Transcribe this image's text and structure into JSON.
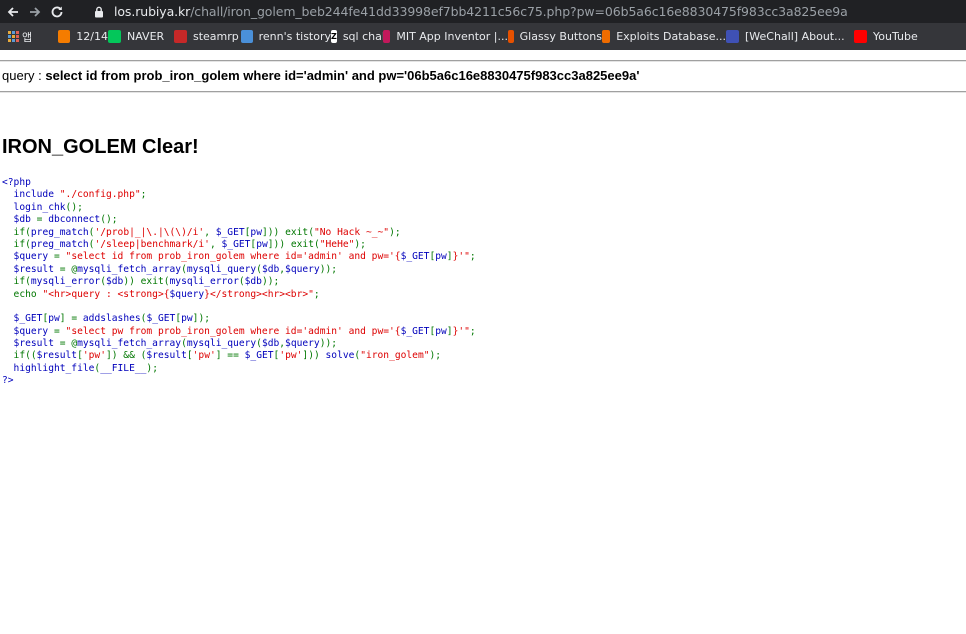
{
  "browser": {
    "url_host": "los.rubiya.kr",
    "url_path": "/chall/iron_golem_beb244fe41dd33998ef7bb4211c56c75.php?pw=06b5a6c16e8830475f983cc3a825ee9a",
    "icons": {
      "back": "back-arrow-icon",
      "forward": "forward-arrow-icon",
      "reload": "reload-icon",
      "lock": "lock-icon"
    }
  },
  "bookmarks": [
    {
      "label": "",
      "icon": "apps-grid-icon"
    },
    {
      "label": "앱",
      "icon": ""
    },
    {
      "label": "12/14",
      "icon": "blogger-icon",
      "color": "#f57c00"
    },
    {
      "label": "NAVER",
      "icon": "naver-icon",
      "color": "#03c75a"
    },
    {
      "label": "steamrp",
      "icon": "steamrp-icon",
      "color": "#c62828"
    },
    {
      "label": "renn's tistory",
      "icon": "tistory-icon",
      "color": "#4a90d9"
    },
    {
      "label": "sql chall",
      "icon": "z-icon",
      "color": "#ffffff"
    },
    {
      "label": "MIT App Inventor |...",
      "icon": "app-inventor-icon",
      "color": "#c2185b"
    },
    {
      "label": "Glassy Buttons",
      "icon": "glassy-buttons-icon",
      "color": "#e65100"
    },
    {
      "label": "Exploits Database...",
      "icon": "exploit-db-icon",
      "color": "#ef6c00"
    },
    {
      "label": "[WeChall] About...",
      "icon": "wechall-icon",
      "color": "#3f51b5"
    },
    {
      "label": "YouTube",
      "icon": "youtube-icon",
      "color": "#ff0000"
    }
  ],
  "page": {
    "query_prefix": "query : ",
    "query_sql": "select id from prob_iron_golem where id='admin' and pw='06b5a6c16e8830475f983cc3a825ee9a'",
    "clear_title": "IRON_GOLEM Clear!",
    "code_lines": [
      [
        {
          "t": "<?php",
          "c": "kw"
        }
      ],
      [
        {
          "t": "  include ",
          "c": "kw"
        },
        {
          "t": "\"./config.php\"",
          "c": "str"
        },
        {
          "t": ";",
          "c": "op"
        }
      ],
      [
        {
          "t": "  login_chk",
          "c": "kw"
        },
        {
          "t": "();",
          "c": "op"
        }
      ],
      [
        {
          "t": "  $db ",
          "c": "kw"
        },
        {
          "t": "= ",
          "c": "op"
        },
        {
          "t": "dbconnect",
          "c": "kw"
        },
        {
          "t": "();",
          "c": "op"
        }
      ],
      [
        {
          "t": "  if(",
          "c": "op"
        },
        {
          "t": "preg_match",
          "c": "kw"
        },
        {
          "t": "(",
          "c": "op"
        },
        {
          "t": "'/prob|_|\\.|\\(\\)/i'",
          "c": "str"
        },
        {
          "t": ", ",
          "c": "op"
        },
        {
          "t": "$_GET",
          "c": "kw"
        },
        {
          "t": "[",
          "c": "op"
        },
        {
          "t": "pw",
          "c": "kw"
        },
        {
          "t": "])) exit(",
          "c": "op"
        },
        {
          "t": "\"No Hack ~_~\"",
          "c": "str"
        },
        {
          "t": ");",
          "c": "op"
        }
      ],
      [
        {
          "t": "  if(",
          "c": "op"
        },
        {
          "t": "preg_match",
          "c": "kw"
        },
        {
          "t": "(",
          "c": "op"
        },
        {
          "t": "'/sleep|benchmark/i'",
          "c": "str"
        },
        {
          "t": ", ",
          "c": "op"
        },
        {
          "t": "$_GET",
          "c": "kw"
        },
        {
          "t": "[",
          "c": "op"
        },
        {
          "t": "pw",
          "c": "kw"
        },
        {
          "t": "])) exit(",
          "c": "op"
        },
        {
          "t": "\"HeHe\"",
          "c": "str"
        },
        {
          "t": ");",
          "c": "op"
        }
      ],
      [
        {
          "t": "  $query ",
          "c": "kw"
        },
        {
          "t": "= ",
          "c": "op"
        },
        {
          "t": "\"select id from prob_iron_golem where id='admin' and pw='{",
          "c": "str"
        },
        {
          "t": "$_GET",
          "c": "kw"
        },
        {
          "t": "[",
          "c": "op"
        },
        {
          "t": "pw",
          "c": "kw"
        },
        {
          "t": "]",
          "c": "op"
        },
        {
          "t": "}'\"",
          "c": "str"
        },
        {
          "t": ";",
          "c": "op"
        }
      ],
      [
        {
          "t": "  $result ",
          "c": "kw"
        },
        {
          "t": "= @",
          "c": "op"
        },
        {
          "t": "mysqli_fetch_array",
          "c": "kw"
        },
        {
          "t": "(",
          "c": "op"
        },
        {
          "t": "mysqli_query",
          "c": "kw"
        },
        {
          "t": "(",
          "c": "op"
        },
        {
          "t": "$db",
          "c": "kw"
        },
        {
          "t": ",",
          "c": "op"
        },
        {
          "t": "$query",
          "c": "kw"
        },
        {
          "t": "));",
          "c": "op"
        }
      ],
      [
        {
          "t": "  if(",
          "c": "op"
        },
        {
          "t": "mysqli_error",
          "c": "kw"
        },
        {
          "t": "(",
          "c": "op"
        },
        {
          "t": "$db",
          "c": "kw"
        },
        {
          "t": ")) exit(",
          "c": "op"
        },
        {
          "t": "mysqli_error",
          "c": "kw"
        },
        {
          "t": "(",
          "c": "op"
        },
        {
          "t": "$db",
          "c": "kw"
        },
        {
          "t": "));",
          "c": "op"
        }
      ],
      [
        {
          "t": "  echo ",
          "c": "op"
        },
        {
          "t": "\"<hr>query : <strong>{",
          "c": "str"
        },
        {
          "t": "$query",
          "c": "kw"
        },
        {
          "t": "}</strong><hr><br>\"",
          "c": "str"
        },
        {
          "t": ";",
          "c": "op"
        }
      ],
      [
        {
          "t": "",
          "c": "op"
        }
      ],
      [
        {
          "t": "  $_GET",
          "c": "kw"
        },
        {
          "t": "[",
          "c": "op"
        },
        {
          "t": "pw",
          "c": "kw"
        },
        {
          "t": "] = ",
          "c": "op"
        },
        {
          "t": "addslashes",
          "c": "kw"
        },
        {
          "t": "(",
          "c": "op"
        },
        {
          "t": "$_GET",
          "c": "kw"
        },
        {
          "t": "[",
          "c": "op"
        },
        {
          "t": "pw",
          "c": "kw"
        },
        {
          "t": "]);",
          "c": "op"
        }
      ],
      [
        {
          "t": "  $query ",
          "c": "kw"
        },
        {
          "t": "= ",
          "c": "op"
        },
        {
          "t": "\"select pw from prob_iron_golem where id='admin' and pw='{",
          "c": "str"
        },
        {
          "t": "$_GET",
          "c": "kw"
        },
        {
          "t": "[",
          "c": "op"
        },
        {
          "t": "pw",
          "c": "kw"
        },
        {
          "t": "]",
          "c": "op"
        },
        {
          "t": "}'\"",
          "c": "str"
        },
        {
          "t": ";",
          "c": "op"
        }
      ],
      [
        {
          "t": "  $result ",
          "c": "kw"
        },
        {
          "t": "= @",
          "c": "op"
        },
        {
          "t": "mysqli_fetch_array",
          "c": "kw"
        },
        {
          "t": "(",
          "c": "op"
        },
        {
          "t": "mysqli_query",
          "c": "kw"
        },
        {
          "t": "(",
          "c": "op"
        },
        {
          "t": "$db",
          "c": "kw"
        },
        {
          "t": ",",
          "c": "op"
        },
        {
          "t": "$query",
          "c": "kw"
        },
        {
          "t": "));",
          "c": "op"
        }
      ],
      [
        {
          "t": "  if((",
          "c": "op"
        },
        {
          "t": "$result",
          "c": "kw"
        },
        {
          "t": "[",
          "c": "op"
        },
        {
          "t": "'pw'",
          "c": "str"
        },
        {
          "t": "]) && (",
          "c": "op"
        },
        {
          "t": "$result",
          "c": "kw"
        },
        {
          "t": "[",
          "c": "op"
        },
        {
          "t": "'pw'",
          "c": "str"
        },
        {
          "t": "] == ",
          "c": "op"
        },
        {
          "t": "$_GET",
          "c": "kw"
        },
        {
          "t": "[",
          "c": "op"
        },
        {
          "t": "'pw'",
          "c": "str"
        },
        {
          "t": "])) ",
          "c": "op"
        },
        {
          "t": "solve",
          "c": "kw"
        },
        {
          "t": "(",
          "c": "op"
        },
        {
          "t": "\"iron_golem\"",
          "c": "str"
        },
        {
          "t": ");",
          "c": "op"
        }
      ],
      [
        {
          "t": "  highlight_file",
          "c": "kw"
        },
        {
          "t": "(",
          "c": "op"
        },
        {
          "t": "__FILE__",
          "c": "kw"
        },
        {
          "t": ");",
          "c": "op"
        }
      ],
      [
        {
          "t": "?>",
          "c": "kw"
        }
      ]
    ]
  }
}
